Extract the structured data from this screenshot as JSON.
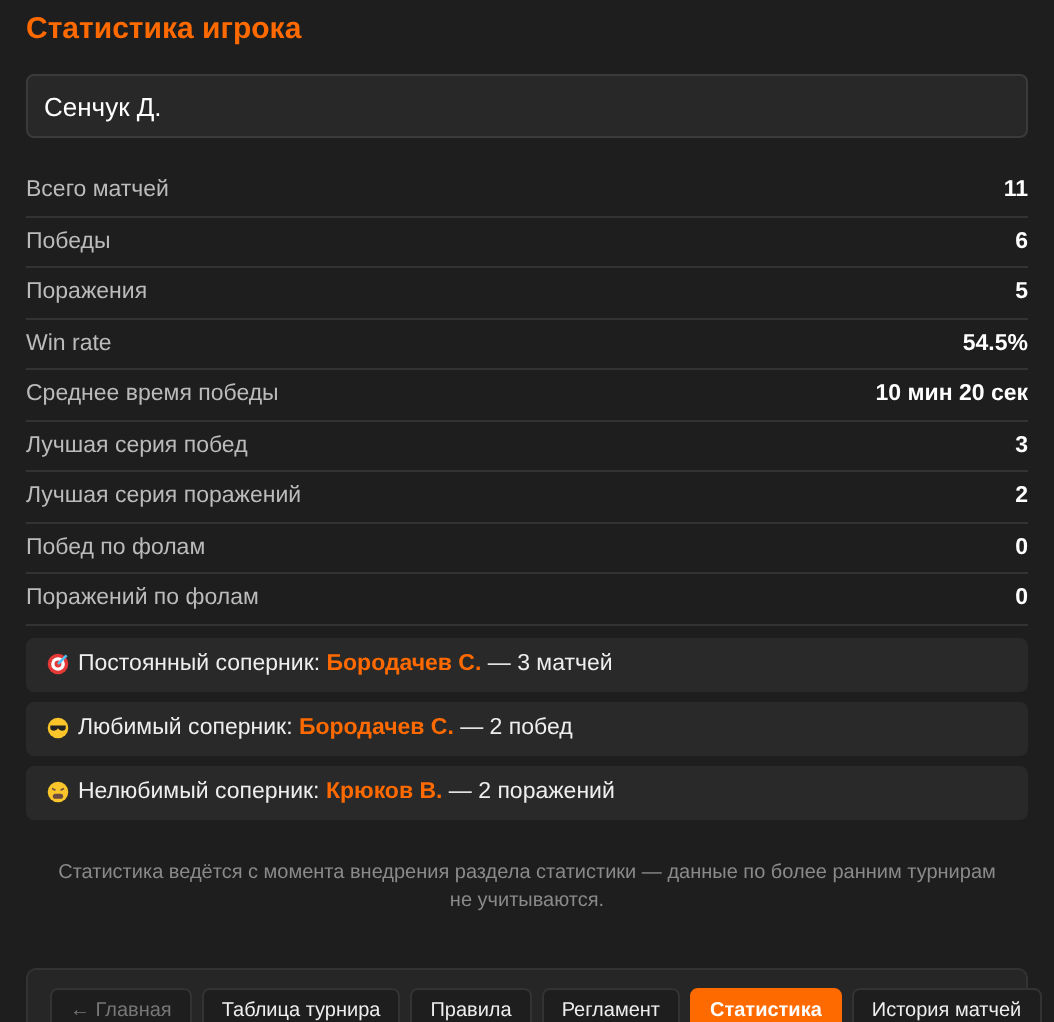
{
  "title": "Статистика игрока",
  "player_field": {
    "value": "Сенчук Д."
  },
  "stats": [
    {
      "label": "Всего матчей",
      "value": "11"
    },
    {
      "label": "Победы",
      "value": "6"
    },
    {
      "label": "Поражения",
      "value": "5"
    },
    {
      "label": "Win rate",
      "value": "54.5%"
    },
    {
      "label": "Среднее время победы",
      "value": "10 мин 20 сек"
    },
    {
      "label": "Лучшая серия побед",
      "value": "3"
    },
    {
      "label": "Лучшая серия поражений",
      "value": "2"
    },
    {
      "label": "Побед по фолам",
      "value": "0"
    },
    {
      "label": "Поражений по фолам",
      "value": "0"
    }
  ],
  "opponents": [
    {
      "kind": "target",
      "text": "Постоянный соперник: **Бородачев С.** — 3 матчей"
    },
    {
      "kind": "cool",
      "text": "Любимый соперник: **Бородачев С.** — 2 побед"
    },
    {
      "kind": "tired",
      "text": "Нелюбимый соперник: **Крюков В.** — 2 поражений"
    }
  ],
  "note": "Статистика ведётся с момента внедрения раздела статистики — данные по более ранним турнирам не учитываются.",
  "nav": [
    {
      "label": "← Главная",
      "selected": false,
      "disabled": true
    },
    {
      "label": "Таблица турнира",
      "selected": false,
      "disabled": false
    },
    {
      "label": "Правила",
      "selected": false,
      "disabled": false
    },
    {
      "label": "Регламент",
      "selected": false,
      "disabled": false
    },
    {
      "label": "Статистика",
      "selected": true,
      "disabled": false
    },
    {
      "label": "История матчей",
      "selected": false,
      "disabled": false
    }
  ]
}
